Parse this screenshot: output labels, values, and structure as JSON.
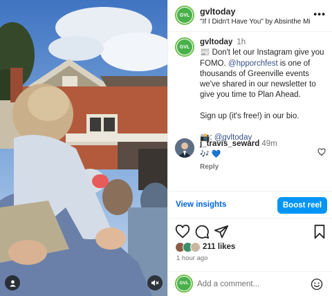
{
  "post": {
    "username": "gvltoday",
    "avatar_text": "GVL",
    "audio_label": "\"If I Didn't Have You\" by Absinthe Min...",
    "caption_time": "1h",
    "caption_line1": "📰 Don't let our Instagram give you FOMO. ",
    "caption_mention": "@hpporchfest",
    "caption_line2": " is one of thousands of Greenville events we've shared in our newsletter to give you time to Plan Ahead.",
    "caption_signup": "Sign up (it's free!) in our bio.",
    "caption_credit_prefix": "📸: ",
    "caption_credit": "@gvltoday"
  },
  "comment": {
    "username": "j_travis_seward",
    "time": "49m",
    "text": "🎶 💙",
    "reply_label": "Reply"
  },
  "insights": {
    "view_label": "View insights",
    "boost_label": "Boost reel"
  },
  "engagement": {
    "likes": "211 likes",
    "time_ago": "1 hour ago"
  },
  "composer": {
    "placeholder": "Add a comment..."
  },
  "colors": {
    "accent_link": "#0064e0",
    "boost_button": "#0095f6",
    "mention": "#385185",
    "brand_green": "#48b04a"
  },
  "icons": {
    "more": "more-options-icon",
    "like": "heart-icon",
    "comment": "comment-icon",
    "share": "share-icon",
    "save": "bookmark-icon",
    "emoji": "emoji-icon",
    "mute": "muted-speaker-icon",
    "tag": "user-tag-icon"
  }
}
